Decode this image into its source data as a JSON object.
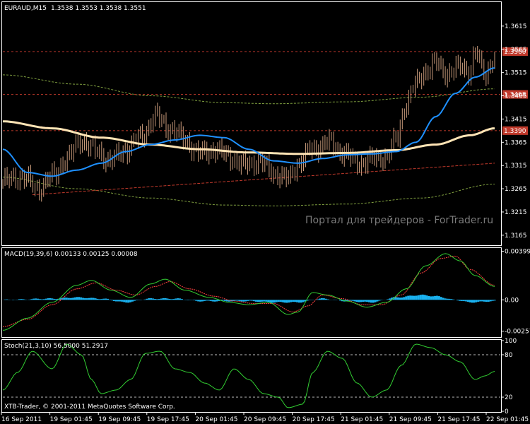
{
  "window": {
    "symbol_label": "EURAUD,M15",
    "ohlc": "1.3538 1.3553 1.3538 1.3551",
    "watermark": "Портал для трейдеров - ForTrader.ru",
    "copyright": "XTB-Trader, © 2001-2011 MetaQuotes Software Corp."
  },
  "colors": {
    "background": "#000000",
    "frame": "#ffffff",
    "candle": "#c89a7a",
    "ma_fast": "#1e90ff",
    "ma_slow": "#ffe4b5",
    "envelope": "#7f9f3f",
    "trendline": "#c0392b",
    "level_line": "#c0392b",
    "macd_hist": "#1ab2f0",
    "macd_signal": "#ff4040",
    "macd_main": "#32cd32",
    "stoch_main": "#32cd32"
  },
  "chart_data": [
    {
      "type": "candlestick",
      "name": "EURAUD,M15 price",
      "ylim": [
        1.3145,
        1.3665
      ],
      "y_ticks": [
        "1.3615",
        "1.3565",
        "1.3515",
        "1.3465",
        "1.3415",
        "1.3365",
        "1.3315",
        "1.3265",
        "1.3215",
        "1.3165"
      ],
      "tick_values": [
        1.3615,
        1.3565,
        1.3515,
        1.3465,
        1.3415,
        1.3365,
        1.3315,
        1.3265,
        1.3215,
        1.3165
      ],
      "x_ticks": [
        "16 Sep 2011",
        "19 Sep 01:45",
        "19 Sep 09:45",
        "19 Sep 17:45",
        "20 Sep 01:45",
        "20 Sep 09:45",
        "20 Sep 17:45",
        "21 Sep 01:45",
        "21 Sep 09:45",
        "21 Sep 17:45",
        "22 Sep 01:45"
      ],
      "close_anchors": [
        [
          0,
          1.328
        ],
        [
          0.04,
          1.3292
        ],
        [
          0.07,
          1.3265
        ],
        [
          0.1,
          1.329
        ],
        [
          0.13,
          1.333
        ],
        [
          0.16,
          1.337
        ],
        [
          0.19,
          1.3345
        ],
        [
          0.22,
          1.3325
        ],
        [
          0.25,
          1.335
        ],
        [
          0.28,
          1.3375
        ],
        [
          0.31,
          1.342
        ],
        [
          0.34,
          1.3395
        ],
        [
          0.37,
          1.337
        ],
        [
          0.4,
          1.334
        ],
        [
          0.43,
          1.335
        ],
        [
          0.46,
          1.3335
        ],
        [
          0.49,
          1.3315
        ],
        [
          0.52,
          1.3325
        ],
        [
          0.55,
          1.33
        ],
        [
          0.58,
          1.3285
        ],
        [
          0.6,
          1.332
        ],
        [
          0.63,
          1.335
        ],
        [
          0.66,
          1.3365
        ],
        [
          0.69,
          1.3345
        ],
        [
          0.72,
          1.332
        ],
        [
          0.75,
          1.3328
        ],
        [
          0.78,
          1.3335
        ],
        [
          0.8,
          1.337
        ],
        [
          0.82,
          1.345
        ],
        [
          0.84,
          1.349
        ],
        [
          0.86,
          1.352
        ],
        [
          0.88,
          1.3535
        ],
        [
          0.9,
          1.3515
        ],
        [
          0.93,
          1.3525
        ],
        [
          0.95,
          1.352
        ],
        [
          0.96,
          1.356
        ],
        [
          0.98,
          1.351
        ],
        [
          1.0,
          1.3551
        ]
      ],
      "ma_fast_anchors": [
        [
          0,
          1.335
        ],
        [
          0.05,
          1.33
        ],
        [
          0.1,
          1.3292
        ],
        [
          0.15,
          1.3305
        ],
        [
          0.2,
          1.332
        ],
        [
          0.25,
          1.3345
        ],
        [
          0.3,
          1.336
        ],
        [
          0.35,
          1.337
        ],
        [
          0.4,
          1.338
        ],
        [
          0.45,
          1.3375
        ],
        [
          0.5,
          1.335
        ],
        [
          0.55,
          1.3325
        ],
        [
          0.6,
          1.332
        ],
        [
          0.65,
          1.333
        ],
        [
          0.7,
          1.3338
        ],
        [
          0.75,
          1.334
        ],
        [
          0.8,
          1.3345
        ],
        [
          0.84,
          1.3365
        ],
        [
          0.88,
          1.342
        ],
        [
          0.92,
          1.347
        ],
        [
          0.96,
          1.3505
        ],
        [
          1.0,
          1.3525
        ]
      ],
      "ma_slow_anchors": [
        [
          0,
          1.341
        ],
        [
          0.1,
          1.3395
        ],
        [
          0.2,
          1.3375
        ],
        [
          0.3,
          1.336
        ],
        [
          0.4,
          1.335
        ],
        [
          0.5,
          1.3343
        ],
        [
          0.6,
          1.334
        ],
        [
          0.7,
          1.3342
        ],
        [
          0.8,
          1.3348
        ],
        [
          0.88,
          1.336
        ],
        [
          0.95,
          1.338
        ],
        [
          1.0,
          1.3395
        ]
      ],
      "envelope_upper_anchors": [
        [
          0,
          1.351
        ],
        [
          0.15,
          1.349
        ],
        [
          0.3,
          1.3465
        ],
        [
          0.45,
          1.345
        ],
        [
          0.55,
          1.3448
        ],
        [
          0.7,
          1.3452
        ],
        [
          0.85,
          1.3462
        ],
        [
          1.0,
          1.348
        ]
      ],
      "envelope_lower_anchors": [
        [
          0,
          1.329
        ],
        [
          0.15,
          1.3265
        ],
        [
          0.3,
          1.3245
        ],
        [
          0.45,
          1.323
        ],
        [
          0.55,
          1.3228
        ],
        [
          0.7,
          1.3232
        ],
        [
          0.85,
          1.3245
        ],
        [
          1.0,
          1.3275
        ]
      ],
      "trendline": [
        [
          0.06,
          1.3252
        ],
        [
          1.0,
          1.332
        ]
      ],
      "levels": [
        {
          "value": 1.356,
          "label": "1.3560"
        },
        {
          "value": 1.3468,
          "label": "1.3468"
        },
        {
          "value": 1.339,
          "label": "1.3390"
        }
      ]
    },
    {
      "type": "line",
      "name": "MACD",
      "title": "MACD(19,39,6) 0.00133 0.00125 0.00008",
      "ylim": [
        -0.003,
        0.0042
      ],
      "y_ticks": [
        "0.00399",
        "0.00",
        "-0.00257"
      ],
      "tick_values": [
        0.00399,
        0.0,
        -0.00257
      ],
      "main_anchors": [
        [
          0,
          -0.0025
        ],
        [
          0.05,
          -0.0015
        ],
        [
          0.1,
          -0.0002
        ],
        [
          0.15,
          0.0012
        ],
        [
          0.18,
          0.0016
        ],
        [
          0.22,
          0.0008
        ],
        [
          0.26,
          0.0002
        ],
        [
          0.3,
          0.0013
        ],
        [
          0.33,
          0.0017
        ],
        [
          0.37,
          0.0008
        ],
        [
          0.42,
          0.0002
        ],
        [
          0.46,
          -0.0002
        ],
        [
          0.5,
          -0.0004
        ],
        [
          0.54,
          -0.0002
        ],
        [
          0.58,
          -0.0012
        ],
        [
          0.6,
          -0.001
        ],
        [
          0.63,
          0.0006
        ],
        [
          0.66,
          0.0004
        ],
        [
          0.7,
          -0.0001
        ],
        [
          0.74,
          -0.0006
        ],
        [
          0.78,
          -0.0002
        ],
        [
          0.82,
          0.0009
        ],
        [
          0.86,
          0.0028
        ],
        [
          0.9,
          0.0038
        ],
        [
          0.93,
          0.0032
        ],
        [
          0.96,
          0.002
        ],
        [
          1.0,
          0.0011
        ]
      ],
      "signal_anchors": [
        [
          0,
          -0.0022
        ],
        [
          0.05,
          -0.0016
        ],
        [
          0.1,
          -0.0004
        ],
        [
          0.15,
          0.0009
        ],
        [
          0.19,
          0.0014
        ],
        [
          0.23,
          0.0008
        ],
        [
          0.27,
          0.0004
        ],
        [
          0.31,
          0.0011
        ],
        [
          0.34,
          0.0015
        ],
        [
          0.38,
          0.0009
        ],
        [
          0.43,
          0.0003
        ],
        [
          0.47,
          -0.0001
        ],
        [
          0.51,
          -0.0003
        ],
        [
          0.55,
          -0.0003
        ],
        [
          0.59,
          -0.001
        ],
        [
          0.62,
          -0.0005
        ],
        [
          0.65,
          0.0004
        ],
        [
          0.69,
          0.0001
        ],
        [
          0.73,
          -0.0004
        ],
        [
          0.77,
          -0.0004
        ],
        [
          0.81,
          0.0004
        ],
        [
          0.85,
          0.0022
        ],
        [
          0.89,
          0.0034
        ],
        [
          0.92,
          0.0036
        ],
        [
          0.95,
          0.0025
        ],
        [
          1.0,
          0.0012
        ]
      ],
      "hist_anchors": [
        [
          0,
          0.0
        ],
        [
          0.1,
          0.0001
        ],
        [
          0.15,
          0.0002
        ],
        [
          0.2,
          0.0001
        ],
        [
          0.25,
          -0.0002
        ],
        [
          0.3,
          0.0001
        ],
        [
          0.35,
          0.0001
        ],
        [
          0.4,
          -0.0001
        ],
        [
          0.5,
          -0.0001
        ],
        [
          0.55,
          -0.0002
        ],
        [
          0.6,
          -0.0002
        ],
        [
          0.65,
          0.0001
        ],
        [
          0.7,
          -0.0001
        ],
        [
          0.75,
          -0.0002
        ],
        [
          0.8,
          0.0002
        ],
        [
          0.85,
          0.0004
        ],
        [
          0.88,
          0.0003
        ],
        [
          0.92,
          0.0
        ],
        [
          0.95,
          -0.0002
        ],
        [
          1.0,
          -0.0001
        ]
      ]
    },
    {
      "type": "line",
      "name": "Stochastic",
      "title": "Stoch(21,3,10) 56.5000 51.2917",
      "ylim": [
        0,
        100
      ],
      "y_ticks": [
        "100",
        "80",
        "20",
        "0"
      ],
      "tick_values": [
        100,
        80,
        20,
        0
      ],
      "levels": [
        80,
        20
      ],
      "main_anchors": [
        [
          0,
          30
        ],
        [
          0.03,
          55
        ],
        [
          0.06,
          85
        ],
        [
          0.1,
          60
        ],
        [
          0.13,
          95
        ],
        [
          0.16,
          80
        ],
        [
          0.18,
          45
        ],
        [
          0.2,
          25
        ],
        [
          0.23,
          30
        ],
        [
          0.26,
          45
        ],
        [
          0.29,
          82
        ],
        [
          0.32,
          85
        ],
        [
          0.35,
          60
        ],
        [
          0.38,
          55
        ],
        [
          0.41,
          40
        ],
        [
          0.44,
          30
        ],
        [
          0.47,
          60
        ],
        [
          0.5,
          45
        ],
        [
          0.53,
          25
        ],
        [
          0.56,
          20
        ],
        [
          0.58,
          5
        ],
        [
          0.61,
          10
        ],
        [
          0.63,
          55
        ],
        [
          0.66,
          85
        ],
        [
          0.69,
          75
        ],
        [
          0.72,
          40
        ],
        [
          0.75,
          20
        ],
        [
          0.78,
          30
        ],
        [
          0.81,
          65
        ],
        [
          0.84,
          95
        ],
        [
          0.87,
          90
        ],
        [
          0.9,
          80
        ],
        [
          0.93,
          70
        ],
        [
          0.96,
          45
        ],
        [
          0.98,
          50
        ],
        [
          1.0,
          56.5
        ]
      ]
    }
  ]
}
